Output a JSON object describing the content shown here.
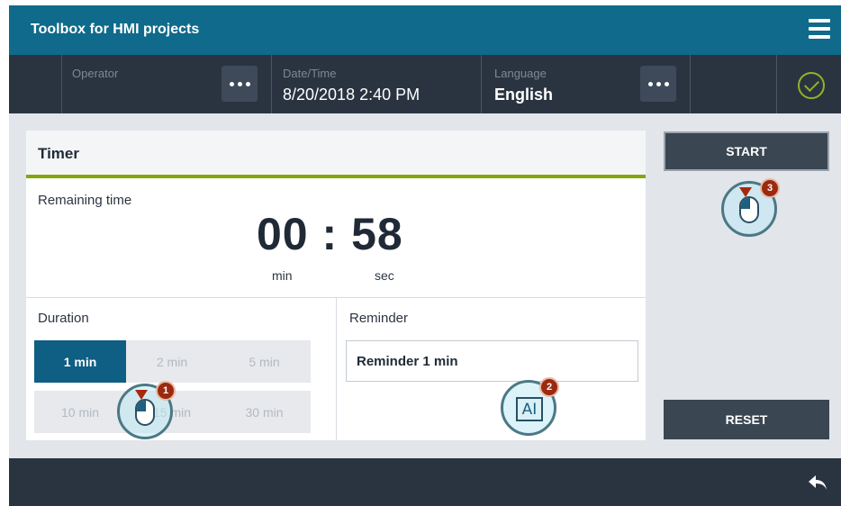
{
  "window": {
    "title": "Toolbox for HMI projects"
  },
  "statusbar": {
    "operator_label": "Operator",
    "datetime_label": "Date/Time",
    "datetime_value": "8/20/2018 2:40 PM",
    "language_label": "Language",
    "language_value": "English",
    "status_icon": "check-circle-icon",
    "status_color": "#8cb528"
  },
  "timer": {
    "title": "Timer",
    "remaining_label": "Remaining time",
    "minutes": "00",
    "separator": ":",
    "seconds": "58",
    "min_unit": "min",
    "sec_unit": "sec"
  },
  "duration": {
    "label": "Duration",
    "options": [
      "1 min",
      "2 min",
      "5 min",
      "10 min",
      "15 min",
      "30 min"
    ],
    "selected": "1 min"
  },
  "reminder": {
    "label": "Reminder",
    "value": "Reminder 1 min"
  },
  "actions": {
    "start_label": "START",
    "reset_label": "RESET"
  },
  "markers": [
    "1",
    "2",
    "3"
  ],
  "colors": {
    "title_bar": "#0f6a8b",
    "dark_bar": "#2a3441",
    "accent_green": "#82a80d",
    "selected_segment": "#0f5e84"
  }
}
